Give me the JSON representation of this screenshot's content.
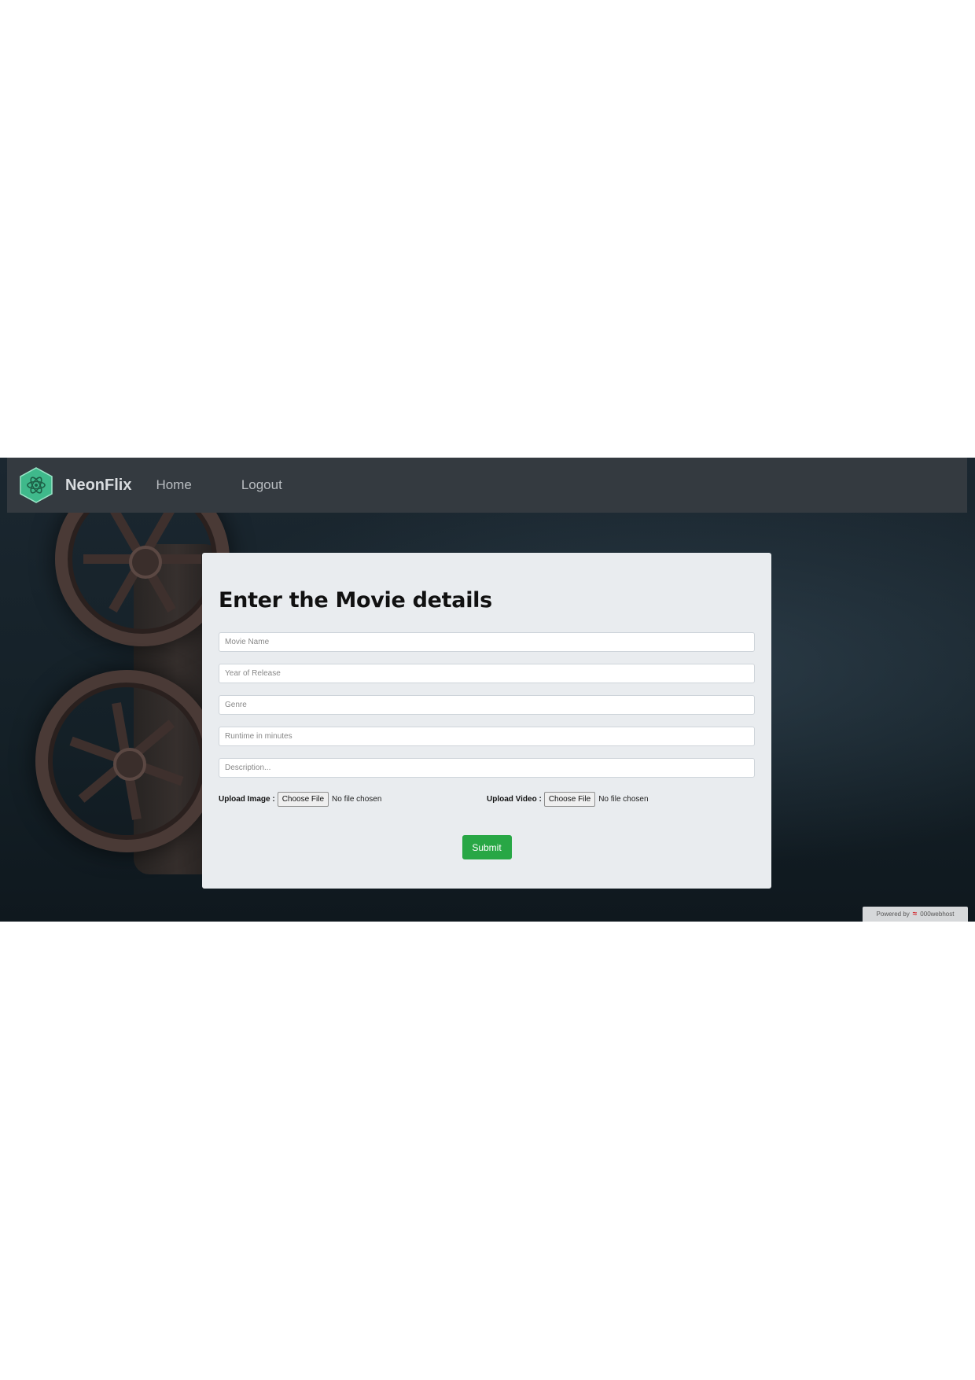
{
  "navbar": {
    "brand": "NeonFlix",
    "links": [
      {
        "label": "Home"
      },
      {
        "label": "Logout"
      }
    ]
  },
  "form": {
    "title": "Enter the Movie details",
    "fields": {
      "movie_name": {
        "placeholder": "Movie Name",
        "value": ""
      },
      "year": {
        "placeholder": "Year of Release",
        "value": ""
      },
      "genre": {
        "placeholder": "Genre",
        "value": ""
      },
      "runtime": {
        "placeholder": "Runtime in minutes",
        "value": ""
      },
      "description": {
        "placeholder": "Description...",
        "value": ""
      }
    },
    "upload_image": {
      "label": "Upload Image :",
      "button": "Choose File",
      "status": "No file chosen"
    },
    "upload_video": {
      "label": "Upload Video :",
      "button": "Choose File",
      "status": "No file chosen"
    },
    "submit_label": "Submit"
  },
  "footer_badge": {
    "prefix": "Powered by",
    "name": "000webhost"
  },
  "colors": {
    "navbar": "#343a40",
    "card": "#e9ecef",
    "submit": "#28a745",
    "logo": "#3fb98b"
  }
}
